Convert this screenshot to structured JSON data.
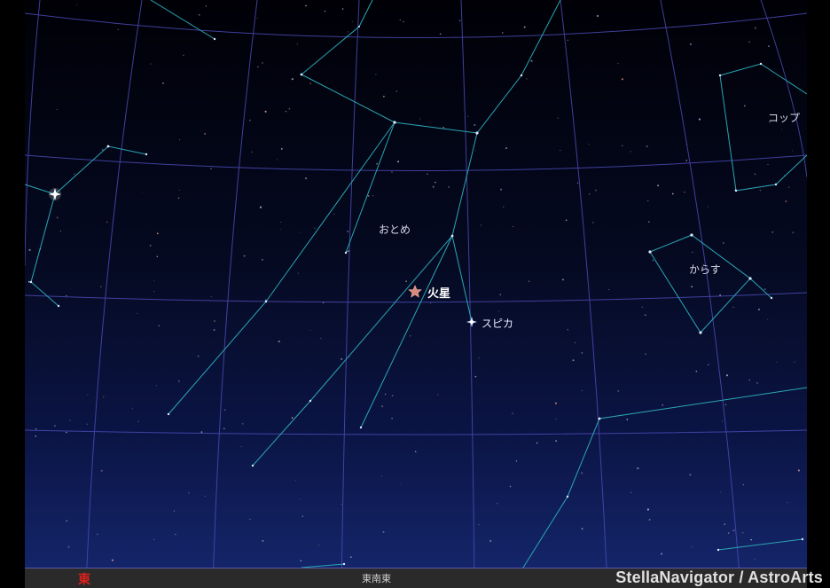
{
  "constellations": {
    "virgo": "おとめ",
    "corvus": "からす",
    "crater": "コップ"
  },
  "objects": {
    "mars": "火星",
    "spica": "スピカ"
  },
  "horizon": {
    "east": "東",
    "ese": "東南東"
  },
  "credit": "StellaNavigator / AstroArts",
  "colors": {
    "sky_top": "#000008",
    "sky_bottom": "#14246a",
    "grid": "#4848b0",
    "constellation_line": "#2aa6b4",
    "mars": "#d98a7c",
    "east_label": "#e0201c"
  }
}
